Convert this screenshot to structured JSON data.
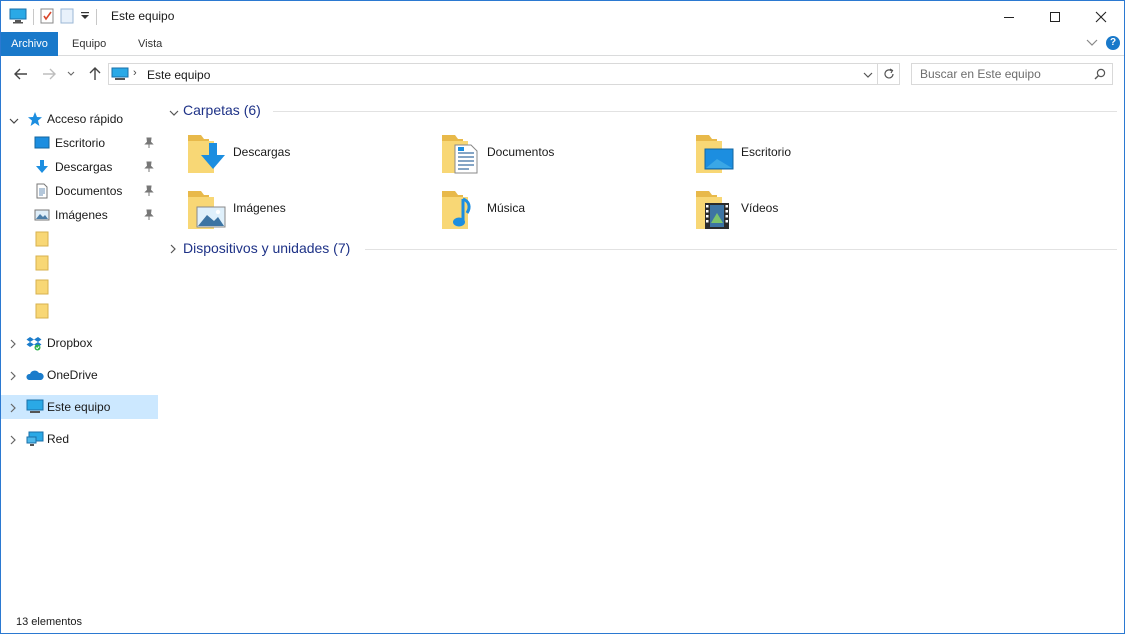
{
  "window": {
    "title": "Este equipo"
  },
  "ribbon": {
    "tabs": [
      {
        "label": "Archivo"
      },
      {
        "label": "Equipo"
      },
      {
        "label": "Vista"
      }
    ],
    "help_label": "?"
  },
  "address": {
    "crumb": "Este equipo",
    "search_placeholder": "Buscar en Este equipo"
  },
  "sidebar": {
    "quick_access": "Acceso rápido",
    "pinned": [
      {
        "label": "Escritorio",
        "icon": "desktop-icon"
      },
      {
        "label": "Descargas",
        "icon": "download-icon"
      },
      {
        "label": "Documentos",
        "icon": "document-icon"
      },
      {
        "label": "Imágenes",
        "icon": "picture-icon"
      }
    ],
    "roots": [
      {
        "label": "Dropbox",
        "icon": "dropbox-icon"
      },
      {
        "label": "OneDrive",
        "icon": "onedrive-icon"
      },
      {
        "label": "Este equipo",
        "icon": "computer-icon",
        "selected": true
      },
      {
        "label": "Red",
        "icon": "network-icon"
      }
    ]
  },
  "content": {
    "folders_group": "Carpetas (6)",
    "folders": [
      {
        "label": "Descargas",
        "overlay": "download"
      },
      {
        "label": "Documentos",
        "overlay": "document"
      },
      {
        "label": "Escritorio",
        "overlay": "desktop"
      },
      {
        "label": "Imágenes",
        "overlay": "picture"
      },
      {
        "label": "Música",
        "overlay": "music"
      },
      {
        "label": "Vídeos",
        "overlay": "video"
      }
    ],
    "devices_group": "Dispositivos y unidades (7)"
  },
  "status": {
    "count": "13 elementos"
  },
  "colors": {
    "accent": "#1979ca",
    "selection": "#cce8ff",
    "group_title": "#1e3287",
    "folder_yellow": "#f8d775"
  }
}
